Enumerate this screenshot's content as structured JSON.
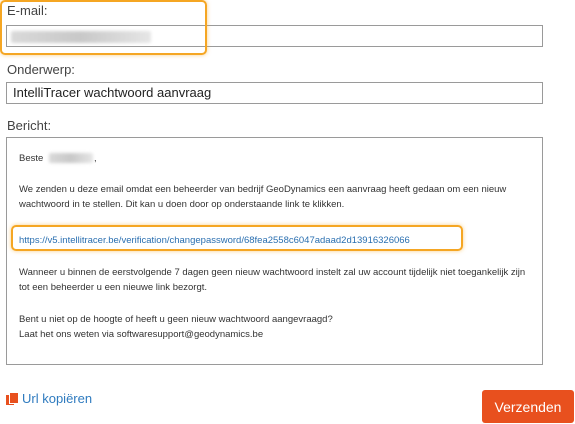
{
  "form": {
    "email_label": "E-mail:",
    "subject_label": "Onderwerp:",
    "subject_value": "IntelliTracer wachtwoord aanvraag",
    "message_label": "Bericht:"
  },
  "message": {
    "greeting": "Beste",
    "greeting_end": ",",
    "paragraph1": "We zenden u deze email omdat een beheerder van bedrijf GeoDynamics een aanvraag heeft gedaan om een nieuw wachtwoord in te stellen. Dit kan u doen door op onderstaande link te klikken.",
    "link": "https://v5.intellitracer.be/verification/changepassword/68fea2558c6047adaad2d13916326066",
    "paragraph2": "Wanneer u binnen de eerstvolgende 7 dagen geen nieuw wachtwoord instelt zal uw account tijdelijk niet toegankelijk zijn tot een beheerder u een nieuwe link bezorgt.",
    "paragraph3_line1": "Bent u niet op de hoogte of heeft u geen nieuw wachtwoord aangevraagd?",
    "paragraph3_line2": "Laat het ons weten via softwaresupport@geodynamics.be"
  },
  "actions": {
    "copy_label": "Url kopiëren",
    "copy_icon": "copy-icon",
    "send_label": "Verzenden"
  },
  "colors": {
    "accent": "#e8501e",
    "highlight": "#f5a623",
    "link": "#2a6fb0"
  }
}
